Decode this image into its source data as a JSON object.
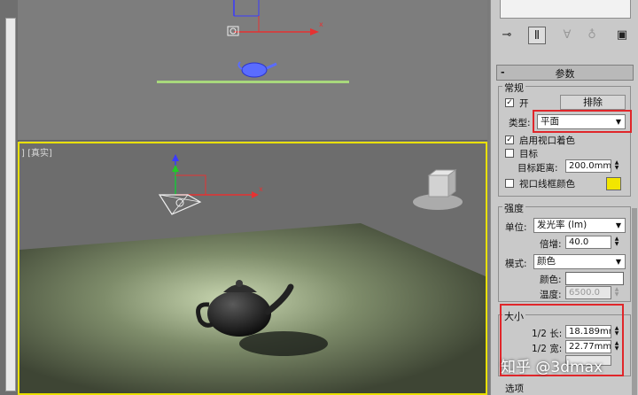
{
  "viewport_label": "] [真实]",
  "watermark": "知乎 @3dmax",
  "panel": {
    "rollout_title": "参数",
    "general": {
      "group_label": "常规",
      "on_label": "开",
      "on_checked": true,
      "exclude_button": "排除",
      "type_label": "类型:",
      "type_value": "平面",
      "targeted_label": "启用视口着色",
      "targeted_checked": true,
      "target_label": "目标",
      "target_checked": false,
      "target_distance_label": "目标距离:",
      "target_distance_value": "200.0mm",
      "wireframe_color_label": "视口线框颜色",
      "wireframe_checked": false,
      "wireframe_color": "#f2e600"
    },
    "intensity": {
      "group_label": "强度",
      "unit_label": "单位:",
      "unit_value": "发光率 (lm)",
      "multiplier_label": "倍增:",
      "multiplier_value": "40.0",
      "mode_label": "模式:",
      "mode_value": "颜色",
      "color_label": "颜色:",
      "color_swatch": "#ffffff",
      "temperature_label": "温度:",
      "temperature_value": "6500.0"
    },
    "size": {
      "group_label": "大小",
      "half_length_label": "1/2 长:",
      "half_length_value": "18.189mm",
      "half_width_label": "1/2 宽:",
      "half_width_value": "22.77mm"
    },
    "options_label": "选项"
  },
  "colors": {
    "highlight_red": "#e0262a",
    "viewport_active": "#e9e000"
  }
}
